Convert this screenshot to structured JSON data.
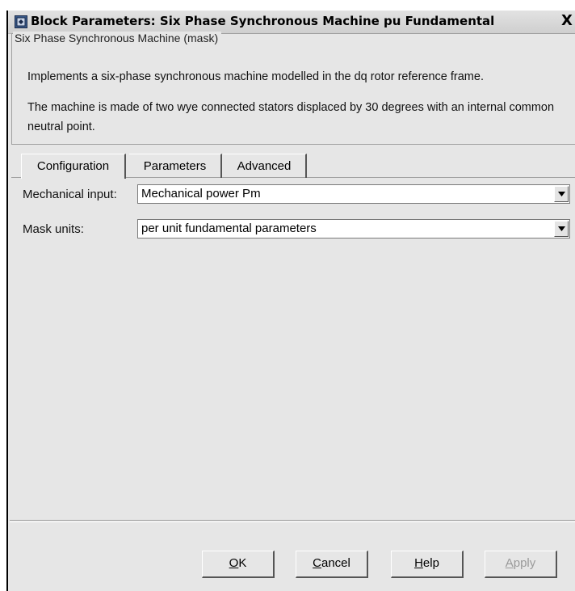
{
  "window": {
    "title": "Block Parameters: Six Phase Synchronous Machine pu Fundamental",
    "close_glyph": "X"
  },
  "mask": {
    "legend": "Six Phase Synchronous Machine (mask)",
    "description_1": "Implements a six-phase synchronous machine modelled in the dq rotor reference frame.",
    "description_2": "The machine is made of two wye connected stators displaced by 30 degrees with an internal common neutral point."
  },
  "tabs": [
    {
      "label": "Configuration",
      "active": true
    },
    {
      "label": "Parameters",
      "active": false
    },
    {
      "label": "Advanced",
      "active": false
    }
  ],
  "fields": {
    "mechanical_input": {
      "label": "Mechanical input:",
      "value": "Mechanical power Pm"
    },
    "mask_units": {
      "label": "Mask units:",
      "value": "per unit fundamental parameters"
    }
  },
  "buttons": {
    "ok": {
      "mnemonic": "O",
      "rest": "K"
    },
    "cancel": {
      "mnemonic": "C",
      "rest": "ancel"
    },
    "help": {
      "mnemonic": "H",
      "rest": "elp"
    },
    "apply": {
      "mnemonic": "A",
      "rest": "pply",
      "enabled": false
    }
  },
  "icons": {
    "window_icon": "simulink-block-icon",
    "dropdown": "chevron-down-icon"
  }
}
